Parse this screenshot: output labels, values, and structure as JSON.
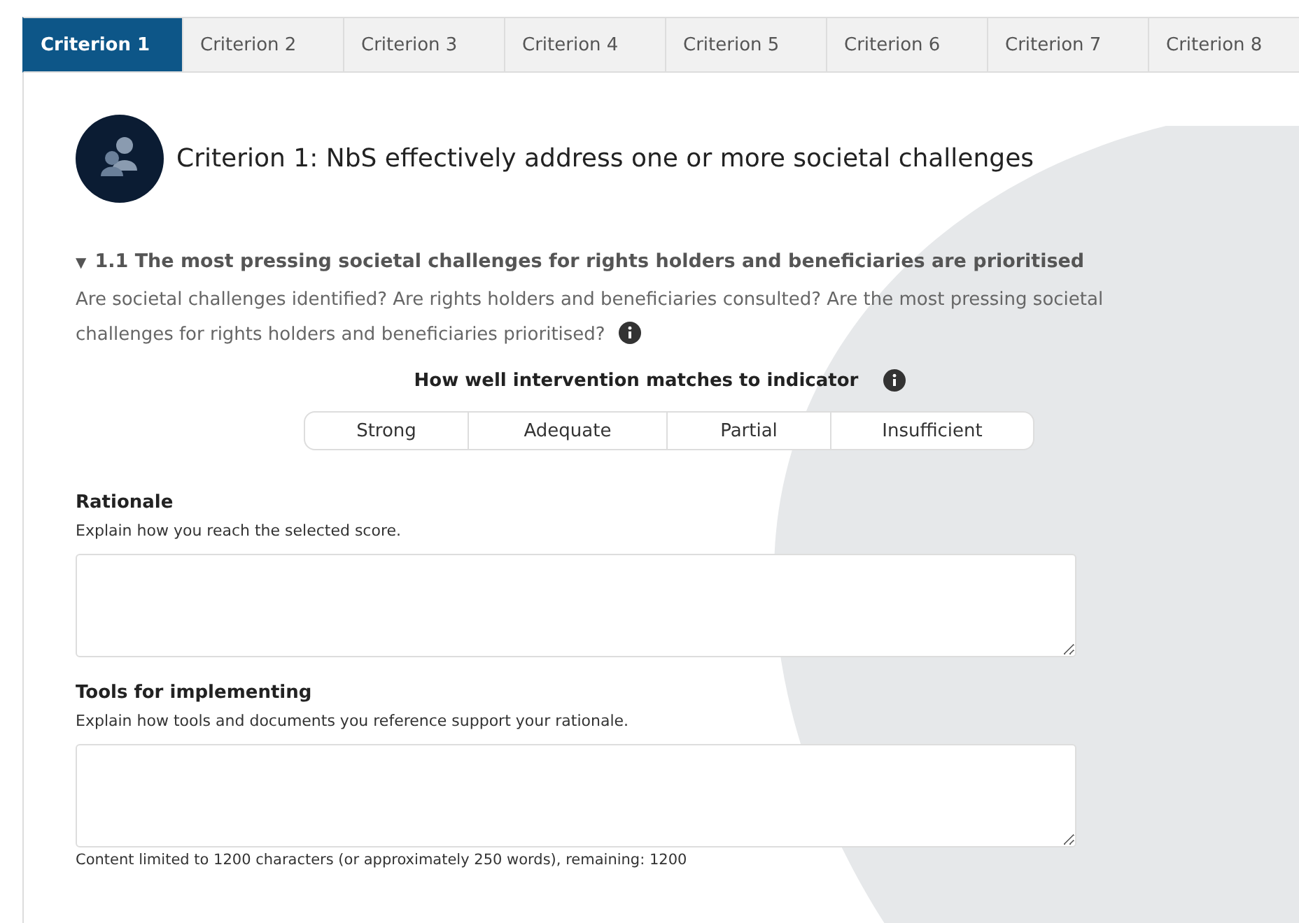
{
  "tabs": [
    {
      "label": "Criterion 1",
      "selected": true
    },
    {
      "label": "Criterion 2",
      "selected": false
    },
    {
      "label": "Criterion 3",
      "selected": false
    },
    {
      "label": "Criterion 4",
      "selected": false
    },
    {
      "label": "Criterion 5",
      "selected": false
    },
    {
      "label": "Criterion 6",
      "selected": false
    },
    {
      "label": "Criterion 7",
      "selected": false
    },
    {
      "label": "Criterion 8",
      "selected": false
    }
  ],
  "criterion": {
    "title": "Criterion 1: NbS effectively address one or more societal challenges"
  },
  "indicator": {
    "expanded": true,
    "marker": "▼",
    "heading": "1.1 The most pressing societal challenges for rights holders and beneficiaries are prioritised",
    "question": "Are societal challenges identified? Are rights holders and beneficiaries consulted? Are the most pressing societal challenges for rights holders and beneficiaries prioritised?"
  },
  "score": {
    "label": "How well intervention matches to indicator",
    "options": [
      {
        "label": "Strong",
        "selected": false
      },
      {
        "label": "Adequate",
        "selected": false
      },
      {
        "label": "Partial",
        "selected": false
      },
      {
        "label": "Insufficient",
        "selected": false
      }
    ]
  },
  "fields": [
    {
      "label": "Rationale",
      "hint": "Explain how you reach the selected score."
    },
    {
      "label": "Tools for implementing",
      "hint": "Explain how tools and documents you reference support your rationale.",
      "note": "Content limited to 1200 characters (or approximately 250 words), remaining: 1200"
    }
  ]
}
